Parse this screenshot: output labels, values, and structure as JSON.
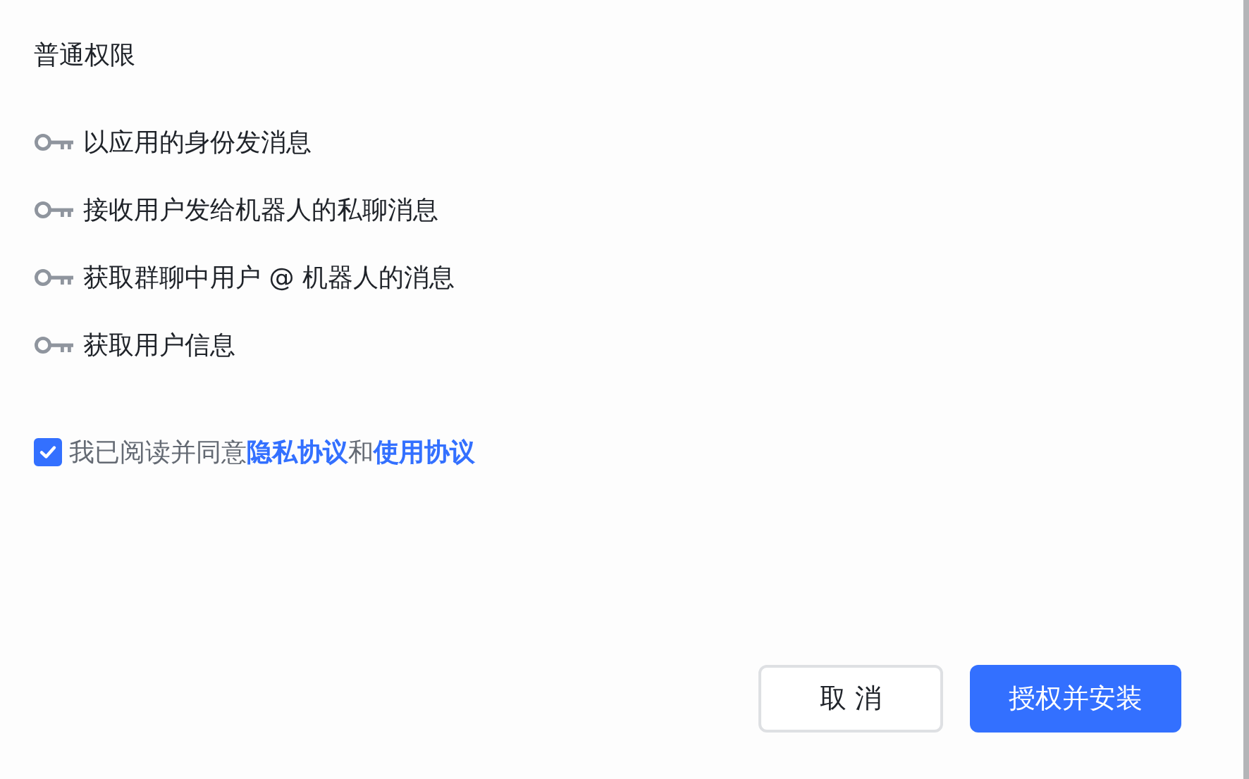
{
  "section_title": "普通权限",
  "permissions": [
    {
      "label": "以应用的身份发消息"
    },
    {
      "label": "接收用户发给机器人的私聊消息"
    },
    {
      "label": "获取群聊中用户 @ 机器人的消息"
    },
    {
      "label": "获取用户信息"
    }
  ],
  "agreement": {
    "checked": true,
    "parts": [
      {
        "kind": "text",
        "text": "我已阅读并同意"
      },
      {
        "kind": "link",
        "text": "隐私协议"
      },
      {
        "kind": "text",
        "text": "和"
      },
      {
        "kind": "link",
        "text": "使用协议"
      }
    ]
  },
  "buttons": [
    {
      "kind": "secondary",
      "label": "取 消"
    },
    {
      "kind": "primary",
      "label": "授权并安装"
    }
  ]
}
